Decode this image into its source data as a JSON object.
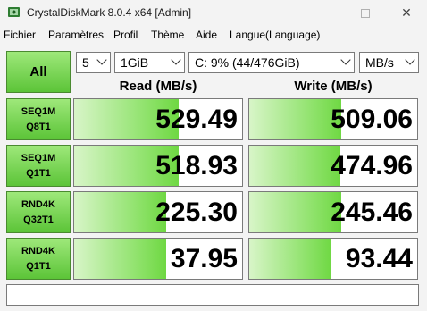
{
  "window": {
    "title": "CrystalDiskMark 8.0.4 x64 [Admin]",
    "close_glyph": "✕"
  },
  "menu": [
    "Fichier",
    "Paramètres",
    "Profil",
    "Thème",
    "Aide",
    "Langue(Language)"
  ],
  "controls": {
    "all_label": "All",
    "count": "5",
    "size": "1GiB",
    "drive": "C: 9% (44/476GiB)",
    "unit": "MB/s"
  },
  "headers": {
    "read": "Read (MB/s)",
    "write": "Write (MB/s)"
  },
  "tests": [
    {
      "line1": "SEQ1M",
      "line2": "Q8T1",
      "read": "529.49",
      "write": "509.06",
      "read_fill": 0.62,
      "write_fill": 0.55
    },
    {
      "line1": "SEQ1M",
      "line2": "Q1T1",
      "read": "518.93",
      "write": "474.96",
      "read_fill": 0.62,
      "write_fill": 0.54
    },
    {
      "line1": "RND4K",
      "line2": "Q32T1",
      "read": "225.30",
      "write": "245.46",
      "read_fill": 0.55,
      "write_fill": 0.55
    },
    {
      "line1": "RND4K",
      "line2": "Q1T1",
      "read": "37.95",
      "write": "93.44",
      "read_fill": 0.55,
      "write_fill": 0.49
    }
  ],
  "colors": {
    "accent_green": "#5cc438",
    "bar_green": "#6fd843"
  }
}
